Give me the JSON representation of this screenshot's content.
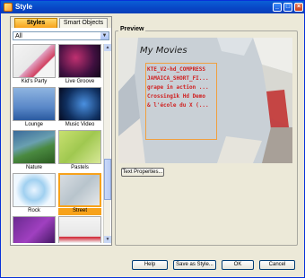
{
  "window": {
    "title": "Style"
  },
  "tabs": [
    {
      "label": "Styles",
      "active": true
    },
    {
      "label": "Smart Objects",
      "active": false
    }
  ],
  "filter": {
    "value": "All"
  },
  "thumbnails": [
    {
      "label": "Kid's Party",
      "selected": false
    },
    {
      "label": "Live Groove",
      "selected": false
    },
    {
      "label": "Lounge",
      "selected": false
    },
    {
      "label": "Music Video",
      "selected": false
    },
    {
      "label": "Nature",
      "selected": false
    },
    {
      "label": "Pastels",
      "selected": false
    },
    {
      "label": "Rock",
      "selected": false
    },
    {
      "label": "Street",
      "selected": true
    },
    {
      "label": "",
      "selected": false
    },
    {
      "label": "",
      "selected": false
    }
  ],
  "preview": {
    "group_label": "Preview",
    "title": "My Movies",
    "lines": [
      "KTE_V2-hd_COMPRESS",
      "JAMAICA_SHORT_FI...",
      "grape in action ...",
      "Crossing1k Hd Demo",
      "& l'école du X (..."
    ],
    "text_properties_label": "Text Properties..."
  },
  "buttons": {
    "help": "Help",
    "save_as_style": "Save as Style...",
    "ok": "OK",
    "cancel": "Cancel"
  },
  "colors": {
    "accent": "#f7a21b",
    "titlebar": "#0845c5",
    "preview_text": "#d02020"
  }
}
